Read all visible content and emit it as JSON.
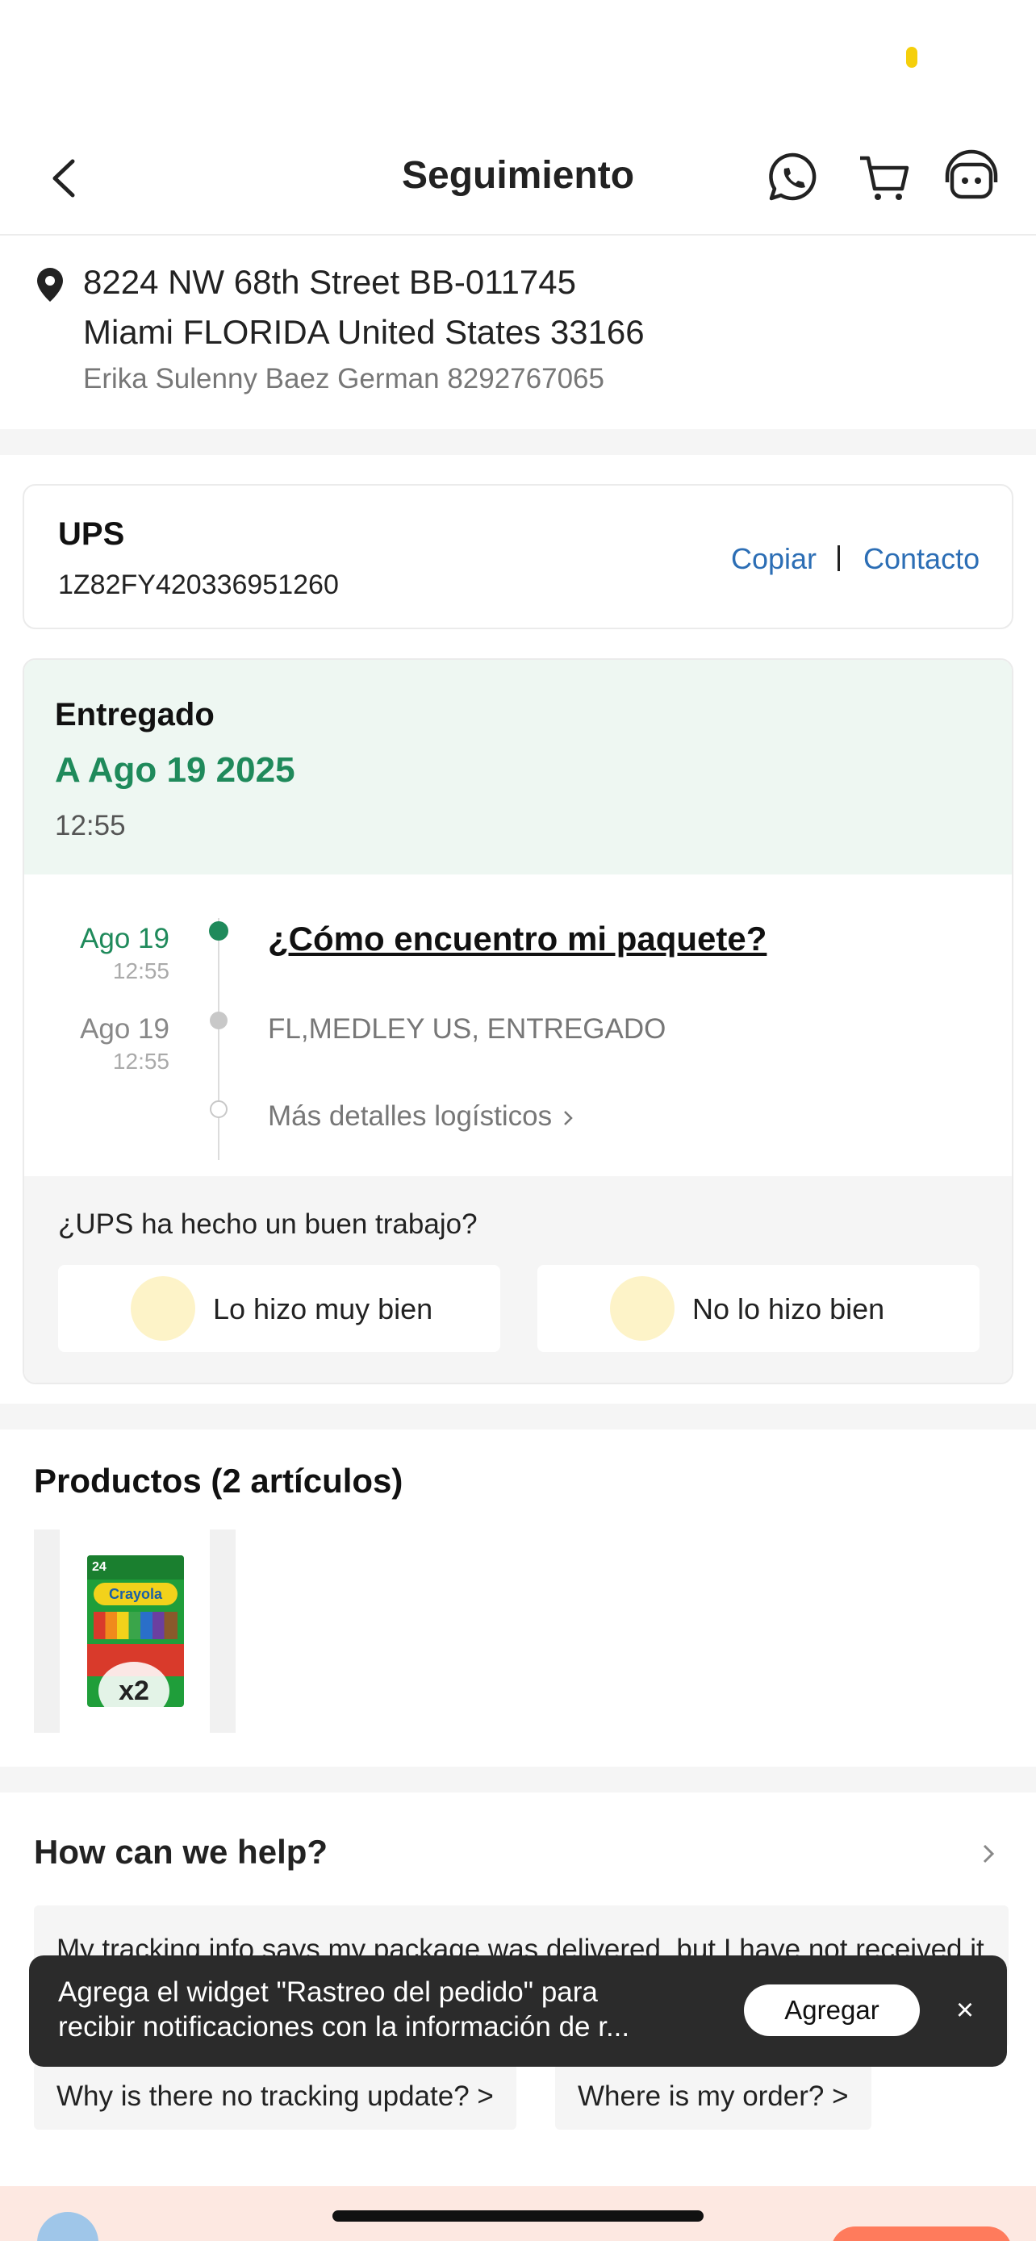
{
  "colors": {
    "accent_green": "#1f8a5b",
    "link_blue": "#2c6eb5",
    "status_bg": "#eef7f2",
    "toast_bg": "#2b2b2b"
  },
  "header": {
    "title": "Seguimiento",
    "icons": [
      "back-arrow-icon",
      "whatsapp-icon",
      "cart-icon",
      "customer-service-icon"
    ]
  },
  "address": {
    "line1": "8224 NW 68th Street BB-011745",
    "line2": "Miami FLORIDA United States 33166",
    "recipient": "Erika Sulenny Baez German 8292767065"
  },
  "carrier": {
    "name": "UPS",
    "tracking_number": "1Z82FY420336951260",
    "copy_label": "Copiar",
    "contact_label": "Contacto"
  },
  "status": {
    "label": "Entregado",
    "date": "A Ago 19 2025",
    "time": "12:55"
  },
  "timeline": {
    "events": [
      {
        "date": "Ago 19",
        "time": "12:55",
        "text": "¿Cómo encuentro mi paquete?"
      },
      {
        "date": "Ago 19",
        "time": "12:55",
        "text": "FL,MEDLEY US, ENTREGADO"
      }
    ],
    "more_label": "Más detalles logísticos"
  },
  "rating": {
    "question": "¿UPS ha hecho un buen trabajo?",
    "good_label": "Lo hizo muy bien",
    "bad_label": "No lo hizo bien"
  },
  "products": {
    "title": "Productos (2 artículos)",
    "items": [
      {
        "brand": "Crayola",
        "count_on_box": "24",
        "quantity": "x2"
      }
    ]
  },
  "help": {
    "title": "How can we help?",
    "questions": [
      "My tracking info says my package was delivered, but I have not received it >",
      "Why is there no tracking update? >",
      "Where is my order? >"
    ]
  },
  "toast": {
    "text_line1": "Agrega el widget \"Rastreo del pedido\" para",
    "text_line2": "recibir notificaciones con la información de r...",
    "add_label": "Agregar",
    "close_symbol": "×"
  }
}
